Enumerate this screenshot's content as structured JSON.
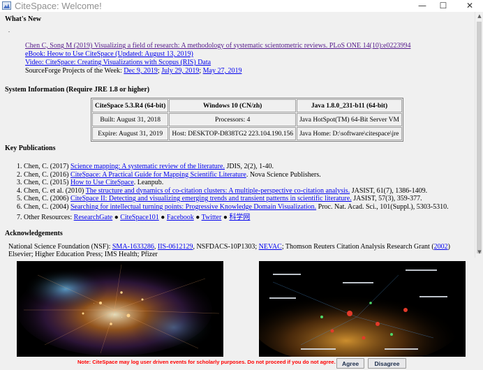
{
  "window": {
    "title": "CiteSpace: Welcome!",
    "controls": {
      "minimize": "—",
      "maximize": "☐",
      "close": "✕"
    }
  },
  "whats_new": {
    "heading": "What's New",
    "items": [
      "Chen C, Song M (2019) Visualizing a field of research: A methodology of systematic scientometric reviews. PLoS ONE 14(10):e0223994",
      "eBook: Heow to Use CiteSpace (Updated: August 13, 2019)",
      "Video: CiteSpace: Creating Visualizations with Scopus (RIS) Data"
    ],
    "sourceforge": {
      "prefix": "SourceForge Projects of the Week:",
      "dates": [
        "Dec 9, 2019",
        "July 29, 2019",
        "May 27, 2019"
      ]
    }
  },
  "system_info": {
    "heading": "System Information (Require JRE 1.8 or higher)",
    "rows": [
      [
        "CiteSpace 5.3.R4 (64-bit)",
        "Windows 10 (CN/zh)",
        "Java 1.8.0_231-b11 (64-bit)"
      ],
      [
        "Built: August 31, 2018",
        "Processors: 4",
        "Java HotSpot(TM) 64-Bit Server VM"
      ],
      [
        "Expire: August 31, 2019",
        "Host: DESKTOP-D838TG2 223.104.190.156",
        "Java Home: D:\\software\\citespace\\jre"
      ]
    ]
  },
  "publications": {
    "heading": "Key Publications",
    "items": [
      {
        "num": "1.",
        "pre": "Chen, C. (2017) ",
        "link": "Science mapping: A systematic review of the literature.",
        "post": " JDIS, 2(2), 1-40."
      },
      {
        "num": "2.",
        "pre": "Chen, C. (2016) ",
        "link": "CiteSpace: A Practical Guide for Mapping Scientific Literature",
        "post": ". Nova Science Publishers."
      },
      {
        "num": "3.",
        "pre": "Chen, C. (2015) ",
        "link": "How to Use CiteSpace",
        "post": ". Leanpub."
      },
      {
        "num": "4.",
        "pre": "Chen, C. et al. (2010) ",
        "link": "The structure and dynamics of co-citation clusters: A multiple-perspective co-citation analysis.",
        "post": " JASIST, 61(7), 1386-1409."
      },
      {
        "num": "5.",
        "pre": "Chen, C. (2006) ",
        "link": "CiteSpace II: Detecting and visualizing emerging trends and transient patterns in scientific literature.",
        "post": " JASIST, 57(3), 359-377."
      },
      {
        "num": "6.",
        "pre": "Chen, C. (2004) ",
        "link": "Searching for intellectual turning points: Progressive Knowledge Domain Visualization.",
        "post": " Proc. Nat. Acad. Sci., 101(Suppl.), 5303-5310."
      }
    ],
    "other": {
      "num": "7.",
      "prefix": "Other Resources: ",
      "links": [
        "ResearchGate",
        "CiteSpace101",
        "Facebook",
        "Twitter",
        "科学网"
      ],
      "separator": "●"
    }
  },
  "acknowledgements": {
    "heading": "Acknowledgements",
    "nsf_prefix": "National Science Foundation (NSF): ",
    "nsf_links": [
      "SMA-1633286",
      "IIS-0612129"
    ],
    "nsf_mid": ", NSFDACS-10P1303; ",
    "nevac": "NEVAC",
    "thomson": "; Thomson Reuters Citation Analysis Research Grant (",
    "year_link": "2002",
    "close": ")",
    "line2": "Elsevier; Higher Education Press; IMS Health; Pfizer"
  },
  "footer": {
    "note": "Note: CiteSpace may log user driven events for scholarly purposes. Do not proceed if you do not agree.",
    "agree": "Agree",
    "disagree": "Disagree"
  },
  "colors": {
    "link": "#0000ee",
    "visited_link": "#551a8b",
    "note": "#ff0000",
    "panel_bg": "#f0f0f0"
  },
  "icons": [
    "citespace-app-icon",
    "minimize-icon",
    "maximize-icon",
    "close-icon",
    "scroll-up-icon",
    "scroll-down-icon"
  ]
}
